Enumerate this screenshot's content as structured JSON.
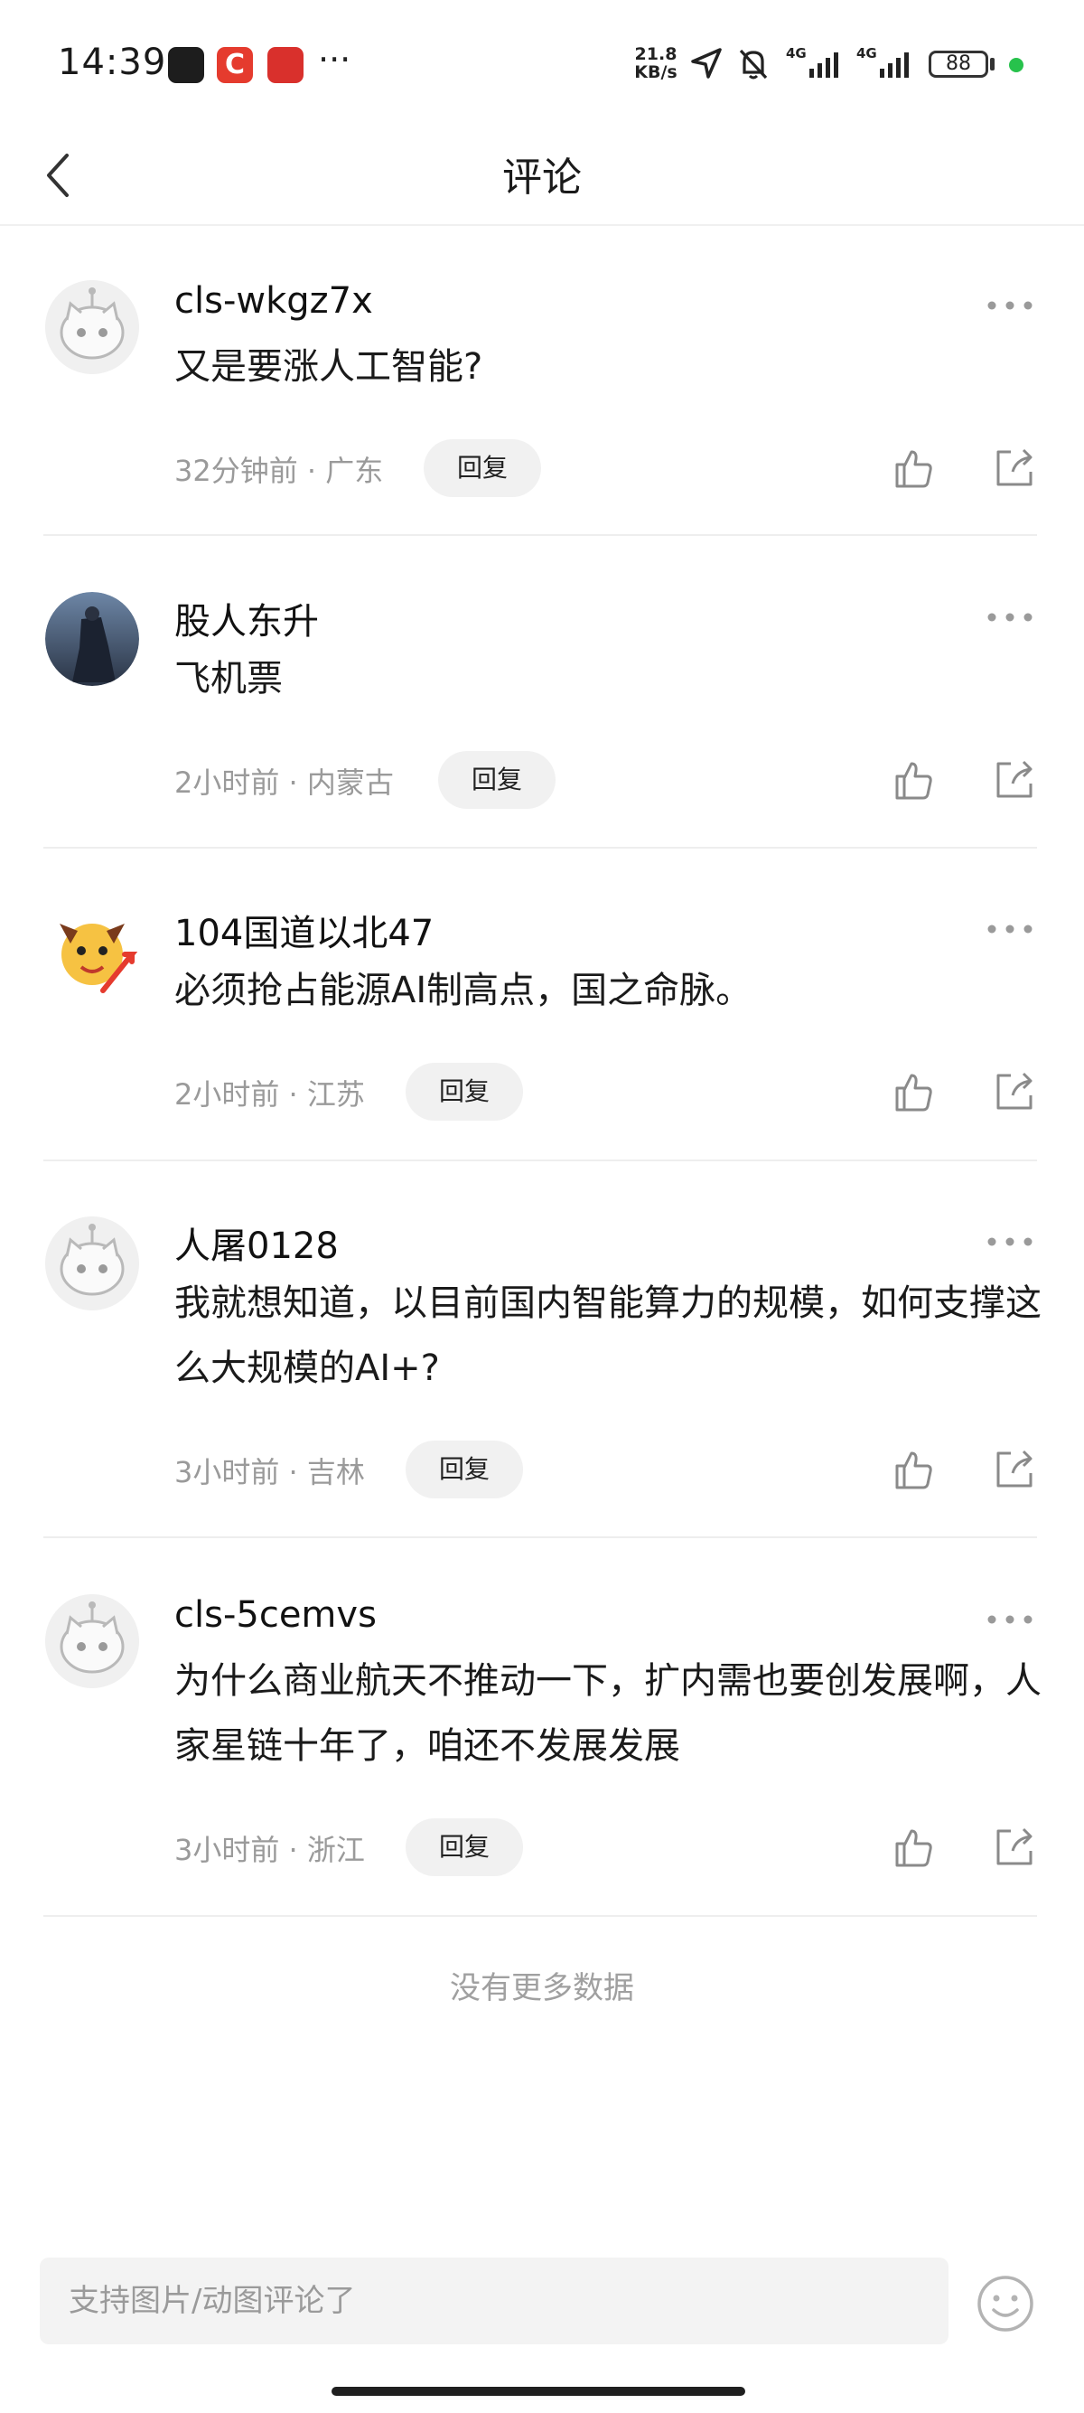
{
  "status_bar": {
    "time": "14:39",
    "app_icon_text": "C",
    "more_dots": "···",
    "net_speed_value": "21.8",
    "net_speed_unit": "KB/s",
    "signal_label_1": "4G",
    "signal_label_2": "4G",
    "battery": "88",
    "icons": [
      "location-arrow-icon",
      "bell-off-icon",
      "signal-icon",
      "battery-icon"
    ]
  },
  "header": {
    "title": "评论",
    "back_icon": "chevron-left-icon"
  },
  "comments": [
    {
      "username": "cls-wkgz7x",
      "text": "又是要涨人工智能?",
      "meta": "32分钟前 · 广东",
      "reply_label": "回复",
      "avatar": "default-cat-avatar"
    },
    {
      "username": "股人东升",
      "text": "飞机票",
      "meta": "2小时前 · 内蒙古",
      "reply_label": "回复",
      "avatar": "photo-avatar"
    },
    {
      "username": "104国道以北47",
      "text": "必须抢占能源AI制高点，国之命脉。",
      "meta": "2小时前 · 江苏",
      "reply_label": "回复",
      "avatar": "cartoon-avatar"
    },
    {
      "username": "人屠0128",
      "text": "我就想知道，以目前国内智能算力的规模，如何支撑这么大规模的AI+?",
      "meta": "3小时前 · 吉林",
      "reply_label": "回复",
      "avatar": "default-cat-avatar"
    },
    {
      "username": "cls-5cemvs",
      "text": "为什么商业航天不推动一下，扩内需也要创发展啊，人家星链十年了，咱还不发展发展",
      "meta": "3小时前 · 浙江",
      "reply_label": "回复",
      "avatar": "default-cat-avatar"
    }
  ],
  "footer": {
    "no_more": "没有更多数据",
    "input_placeholder": "支持图片/动图评论了"
  },
  "colors": {
    "meta_text": "#9a9a9a",
    "reply_bg": "#f1f1f1",
    "divider": "#eeeeee",
    "status_green": "#27c24c"
  }
}
